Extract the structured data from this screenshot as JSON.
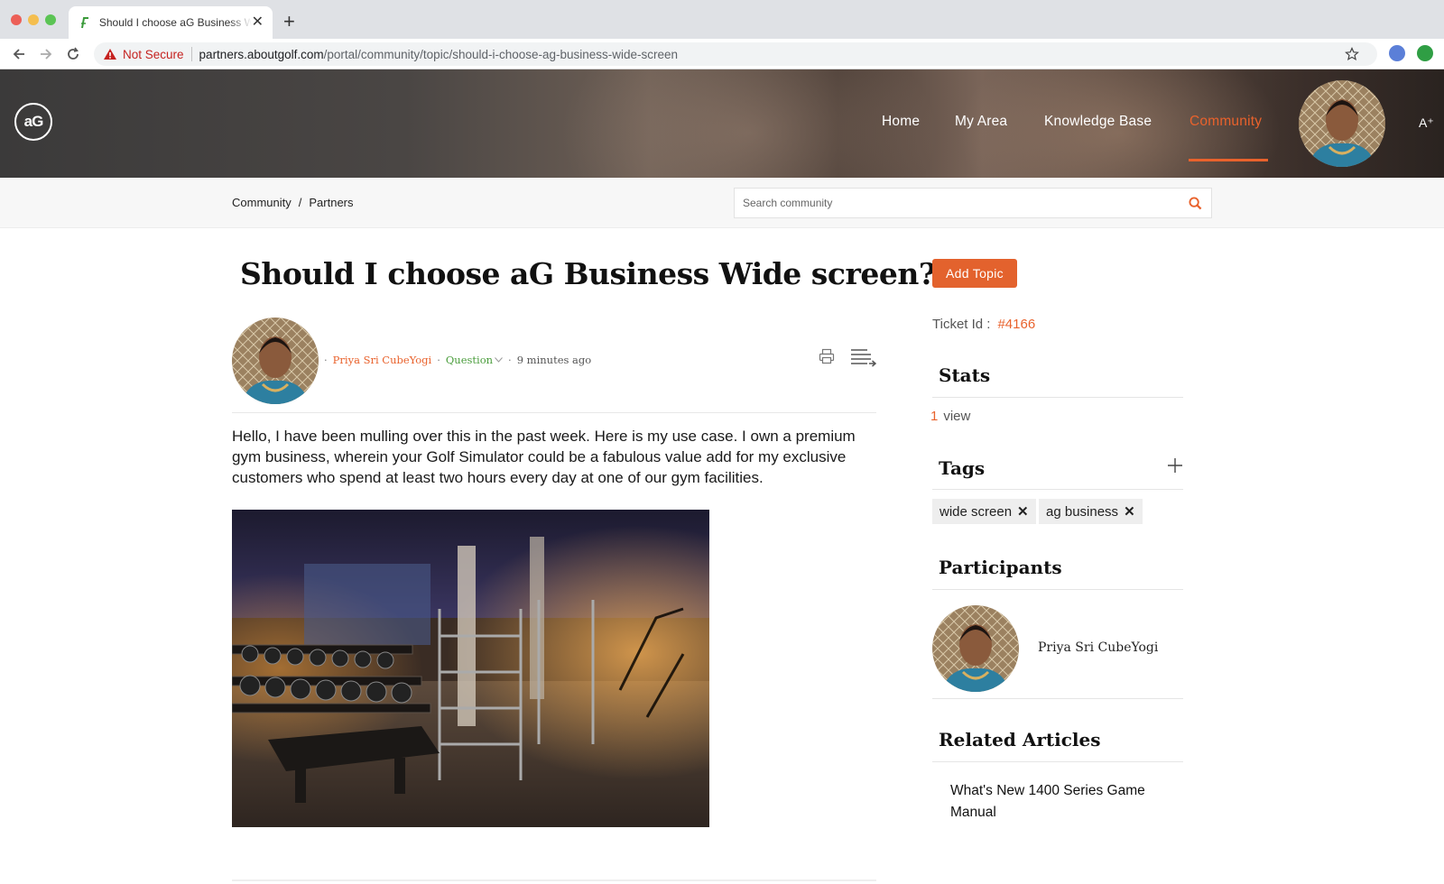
{
  "browser": {
    "tab_title": "Should I choose aG Business Wide screen?",
    "security_label": "Not Secure",
    "url_host": "partners.aboutgolf.com",
    "url_path": "/portal/community/topic/should-i-choose-ag-business-wide-screen"
  },
  "header": {
    "logo_text": "aG",
    "nav": [
      {
        "label": "Home"
      },
      {
        "label": "My Area"
      },
      {
        "label": "Knowledge Base"
      },
      {
        "label": "Community",
        "active": true
      }
    ],
    "font_size_label": "A⁺"
  },
  "subbar": {
    "breadcrumb": [
      "Community",
      "/",
      "Partners"
    ],
    "search_placeholder": "Search community"
  },
  "topic": {
    "title": "Should I choose aG Business Wide screen?",
    "author": "Priya Sri CubeYogi",
    "type": "Question",
    "time": "9 minutes ago",
    "body": "Hello, I have been mulling over this in the past week. Here is my use case. I own a premium gym business, wherein your Golf Simulator could be a fabulous value add for my exclusive customers who spend at least two hours every day at one of our gym facilities."
  },
  "sidebar": {
    "add_topic_label": "Add Topic",
    "ticket_label": "Ticket Id :",
    "ticket_id": "#4166",
    "stats_heading": "Stats",
    "views_count": "1",
    "views_label": "view",
    "tags_heading": "Tags",
    "tags": [
      "wide screen",
      "ag business"
    ],
    "participants_heading": "Participants",
    "participants": [
      "Priya Sri CubeYogi"
    ],
    "related_heading": "Related Articles",
    "related": [
      "What's New 1400 Series Game Manual"
    ]
  },
  "colors": {
    "accent": "#e9622c",
    "question_green": "#4a9d3c"
  }
}
